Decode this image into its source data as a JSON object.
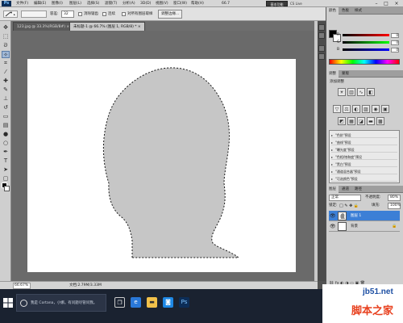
{
  "app": {
    "logo": "Ps"
  },
  "menu": {
    "items": [
      "文件(F)",
      "编辑(E)",
      "图像(I)",
      "图层(L)",
      "选择(S)",
      "滤镜(T)",
      "分析(A)",
      "3D(D)",
      "视图(V)",
      "窗口(W)",
      "帮助(H)"
    ],
    "zoom": "66.7",
    "essentials": "基本功能",
    "cs_live": "CS Live"
  },
  "options": {
    "feather_label": "容差:",
    "feather_value": "32",
    "antialias": "消除锯齿",
    "contiguous": "连续",
    "sample_all": "对所有图层取样",
    "refine_edge": "调整边缘..."
  },
  "tabs": [
    {
      "label": "123.jpg @ 33.3%(RGB/8#) ×"
    },
    {
      "label": "未标题-1 @ 66.7% (图层 1, RGB/8) * ×"
    }
  ],
  "status": {
    "zoom": "66.67%",
    "doc_info": "文档:2.79M/3.33M"
  },
  "panels": {
    "color_tabs": [
      "颜色",
      "色板",
      "样式"
    ],
    "color_values": {
      "r": "0",
      "g": "0",
      "b": "0"
    },
    "adjust_tabs": [
      "调整",
      "蒙版"
    ],
    "adjust_title": "添加调整",
    "presets": [
      "\"色阶\"预设",
      "\"曲线\"预设",
      "\"曝光度\"预设",
      "\"色相/饱和度\"预设",
      "\"黑白\"预设",
      "\"通道混合器\"预设",
      "\"可选颜色\"预设"
    ],
    "layers_tabs": [
      "图层",
      "通道",
      "路径"
    ],
    "blend_mode": "正常",
    "opacity_label": "不透明度:",
    "opacity_value": "80%",
    "lock_label": "锁定:",
    "fill_label": "填充:",
    "fill_value": "100%",
    "layers": [
      {
        "name": "图层 1"
      },
      {
        "name": "背景"
      }
    ]
  },
  "taskbar": {
    "search_text": "我是 Cortana，小娜。有问题尽管问我。"
  },
  "watermark": {
    "url": "jb51.net",
    "brand": "脚本之家"
  },
  "colors": {
    "selection_fill": "#c6c6c6",
    "layer_selected": "#3c7fd6",
    "canvas_bg": "#6a6a6a"
  }
}
